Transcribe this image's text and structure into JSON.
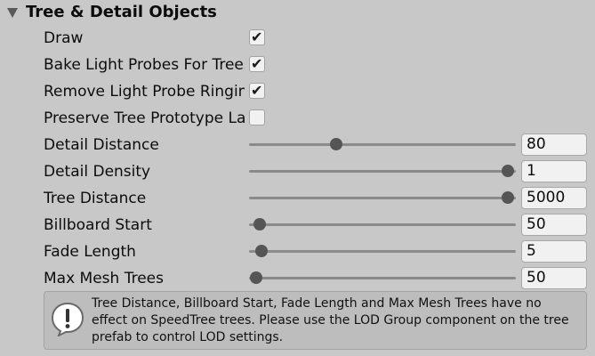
{
  "section": {
    "title": "Tree & Detail Objects",
    "expanded": true
  },
  "rows": [
    {
      "label": "Draw",
      "type": "checkbox",
      "checked": true
    },
    {
      "label": "Bake Light Probes For Trees",
      "type": "checkbox",
      "checked": true
    },
    {
      "label": "Remove Light Probe Ringing",
      "type": "checkbox",
      "checked": true
    },
    {
      "label": "Preserve Tree Prototype Layers",
      "type": "checkbox",
      "checked": false
    },
    {
      "label": "Detail Distance",
      "type": "slider",
      "value": "80",
      "fraction": 0.325
    },
    {
      "label": "Detail Density",
      "type": "slider",
      "value": "1",
      "fraction": 0.97
    },
    {
      "label": "Tree Distance",
      "type": "slider",
      "value": "5000",
      "fraction": 0.97
    },
    {
      "label": "Billboard Start",
      "type": "slider",
      "value": "50",
      "fraction": 0.04
    },
    {
      "label": "Fade Length",
      "type": "slider",
      "value": "5",
      "fraction": 0.045
    },
    {
      "label": "Max Mesh Trees",
      "type": "slider",
      "value": "50",
      "fraction": 0.025
    }
  ],
  "help": {
    "icon": "info-speech-bubble-icon",
    "text": "Tree Distance, Billboard Start, Fade Length and Max Mesh Trees have no effect on SpeedTree trees. Please use the LOD Group component on the tree prefab to control LOD settings."
  }
}
